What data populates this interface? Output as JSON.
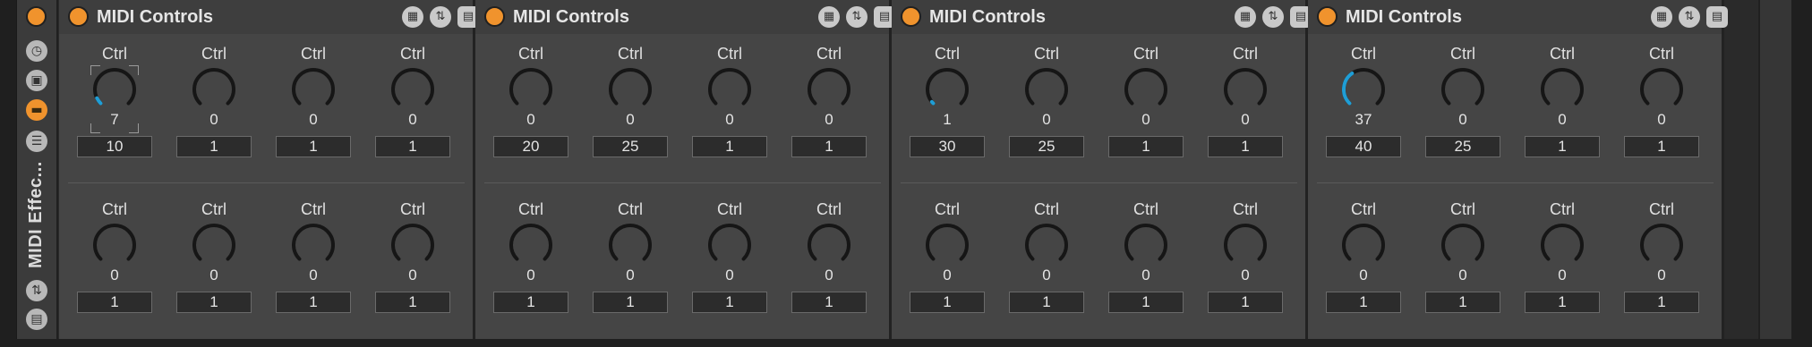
{
  "sidebar": {
    "label": "MIDI Effec...",
    "icons": [
      "power-icon",
      "clock-icon",
      "camera-icon",
      "macro-icon",
      "list-icon",
      "shuffle-icon",
      "save-icon"
    ]
  },
  "devices": [
    {
      "title": "MIDI Controls",
      "top": [
        {
          "label": "Ctrl",
          "value": "7",
          "amount": "10",
          "fill": 0.07,
          "focused": true
        },
        {
          "label": "Ctrl",
          "value": "0",
          "amount": "1",
          "fill": 0
        },
        {
          "label": "Ctrl",
          "value": "0",
          "amount": "1",
          "fill": 0
        },
        {
          "label": "Ctrl",
          "value": "0",
          "amount": "1",
          "fill": 0
        }
      ],
      "bottom": [
        {
          "label": "Ctrl",
          "value": "0",
          "amount": "1",
          "fill": 0
        },
        {
          "label": "Ctrl",
          "value": "0",
          "amount": "1",
          "fill": 0
        },
        {
          "label": "Ctrl",
          "value": "0",
          "amount": "1",
          "fill": 0
        },
        {
          "label": "Ctrl",
          "value": "0",
          "amount": "1",
          "fill": 0
        }
      ]
    },
    {
      "title": "MIDI Controls",
      "top": [
        {
          "label": "Ctrl",
          "value": "0",
          "amount": "20",
          "fill": 0
        },
        {
          "label": "Ctrl",
          "value": "0",
          "amount": "25",
          "fill": 0
        },
        {
          "label": "Ctrl",
          "value": "0",
          "amount": "1",
          "fill": 0
        },
        {
          "label": "Ctrl",
          "value": "0",
          "amount": "1",
          "fill": 0
        }
      ],
      "bottom": [
        {
          "label": "Ctrl",
          "value": "0",
          "amount": "1",
          "fill": 0
        },
        {
          "label": "Ctrl",
          "value": "0",
          "amount": "1",
          "fill": 0
        },
        {
          "label": "Ctrl",
          "value": "0",
          "amount": "1",
          "fill": 0
        },
        {
          "label": "Ctrl",
          "value": "0",
          "amount": "1",
          "fill": 0
        }
      ]
    },
    {
      "title": "MIDI Controls",
      "top": [
        {
          "label": "Ctrl",
          "value": "1",
          "amount": "30",
          "fill": 0.01
        },
        {
          "label": "Ctrl",
          "value": "0",
          "amount": "25",
          "fill": 0
        },
        {
          "label": "Ctrl",
          "value": "0",
          "amount": "1",
          "fill": 0
        },
        {
          "label": "Ctrl",
          "value": "0",
          "amount": "1",
          "fill": 0
        }
      ],
      "bottom": [
        {
          "label": "Ctrl",
          "value": "0",
          "amount": "1",
          "fill": 0
        },
        {
          "label": "Ctrl",
          "value": "0",
          "amount": "1",
          "fill": 0
        },
        {
          "label": "Ctrl",
          "value": "0",
          "amount": "1",
          "fill": 0
        },
        {
          "label": "Ctrl",
          "value": "0",
          "amount": "1",
          "fill": 0
        }
      ]
    },
    {
      "title": "MIDI Controls",
      "top": [
        {
          "label": "Ctrl",
          "value": "37",
          "amount": "40",
          "fill": 0.37
        },
        {
          "label": "Ctrl",
          "value": "0",
          "amount": "25",
          "fill": 0
        },
        {
          "label": "Ctrl",
          "value": "0",
          "amount": "1",
          "fill": 0
        },
        {
          "label": "Ctrl",
          "value": "0",
          "amount": "1",
          "fill": 0
        }
      ],
      "bottom": [
        {
          "label": "Ctrl",
          "value": "0",
          "amount": "1",
          "fill": 0
        },
        {
          "label": "Ctrl",
          "value": "0",
          "amount": "1",
          "fill": 0
        },
        {
          "label": "Ctrl",
          "value": "0",
          "amount": "1",
          "fill": 0
        },
        {
          "label": "Ctrl",
          "value": "0",
          "amount": "1",
          "fill": 0
        }
      ]
    }
  ],
  "colors": {
    "accent": "#f0932d",
    "knob_fill": "#1f9ed6",
    "knob_ring": "#161616",
    "panel": "#454545"
  }
}
